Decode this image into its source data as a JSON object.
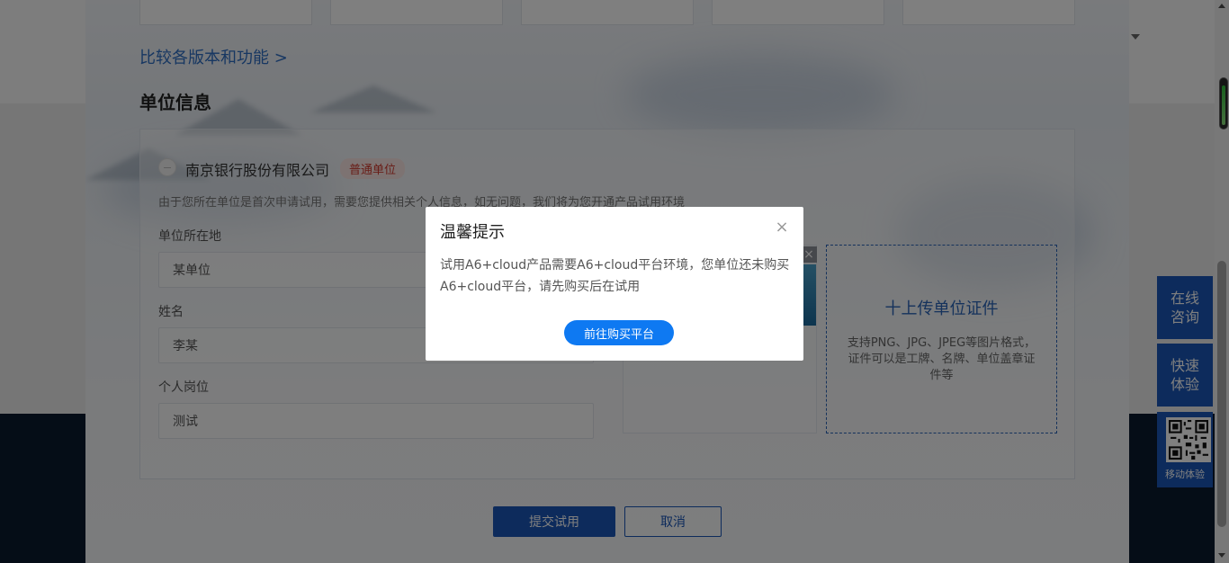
{
  "plan_section": {
    "compare_link": "比较各版本和功能 >"
  },
  "unit_info": {
    "title": "单位信息",
    "company_name": "南京银行股份有限公司",
    "company_badge": "普通单位",
    "hint": "由于您所在单位是首次申请试用，需要您提供相关个人信息，如无问题，我们将为您开通产品试用环境",
    "fields": [
      {
        "label": "单位所在地",
        "value": "某单位"
      },
      {
        "label": "姓名",
        "value": "李某"
      },
      {
        "label": "个人岗位",
        "value": "测试"
      }
    ],
    "upload": {
      "title": "十上传单位证件",
      "desc": "支持PNG、JPG、JPEG等图片格式，证件可以是工牌、名牌、单位盖章证件等"
    }
  },
  "actions": {
    "submit": "提交试用",
    "cancel": "取消"
  },
  "side": {
    "consult": "在线咨询",
    "trial": "快速体验",
    "mobile": "移动体验"
  },
  "modal": {
    "title": "温馨提示",
    "close": "×",
    "body": "试用A6+cloud产品需要A6+cloud平台环境，您单位还未购买A6+cloud平台，请先购买后在试用",
    "button": "前往购买平台"
  },
  "colors": {
    "primary": "#1a57b8",
    "modal_button": "#0e79f2",
    "badge_text": "#d23a2f"
  }
}
